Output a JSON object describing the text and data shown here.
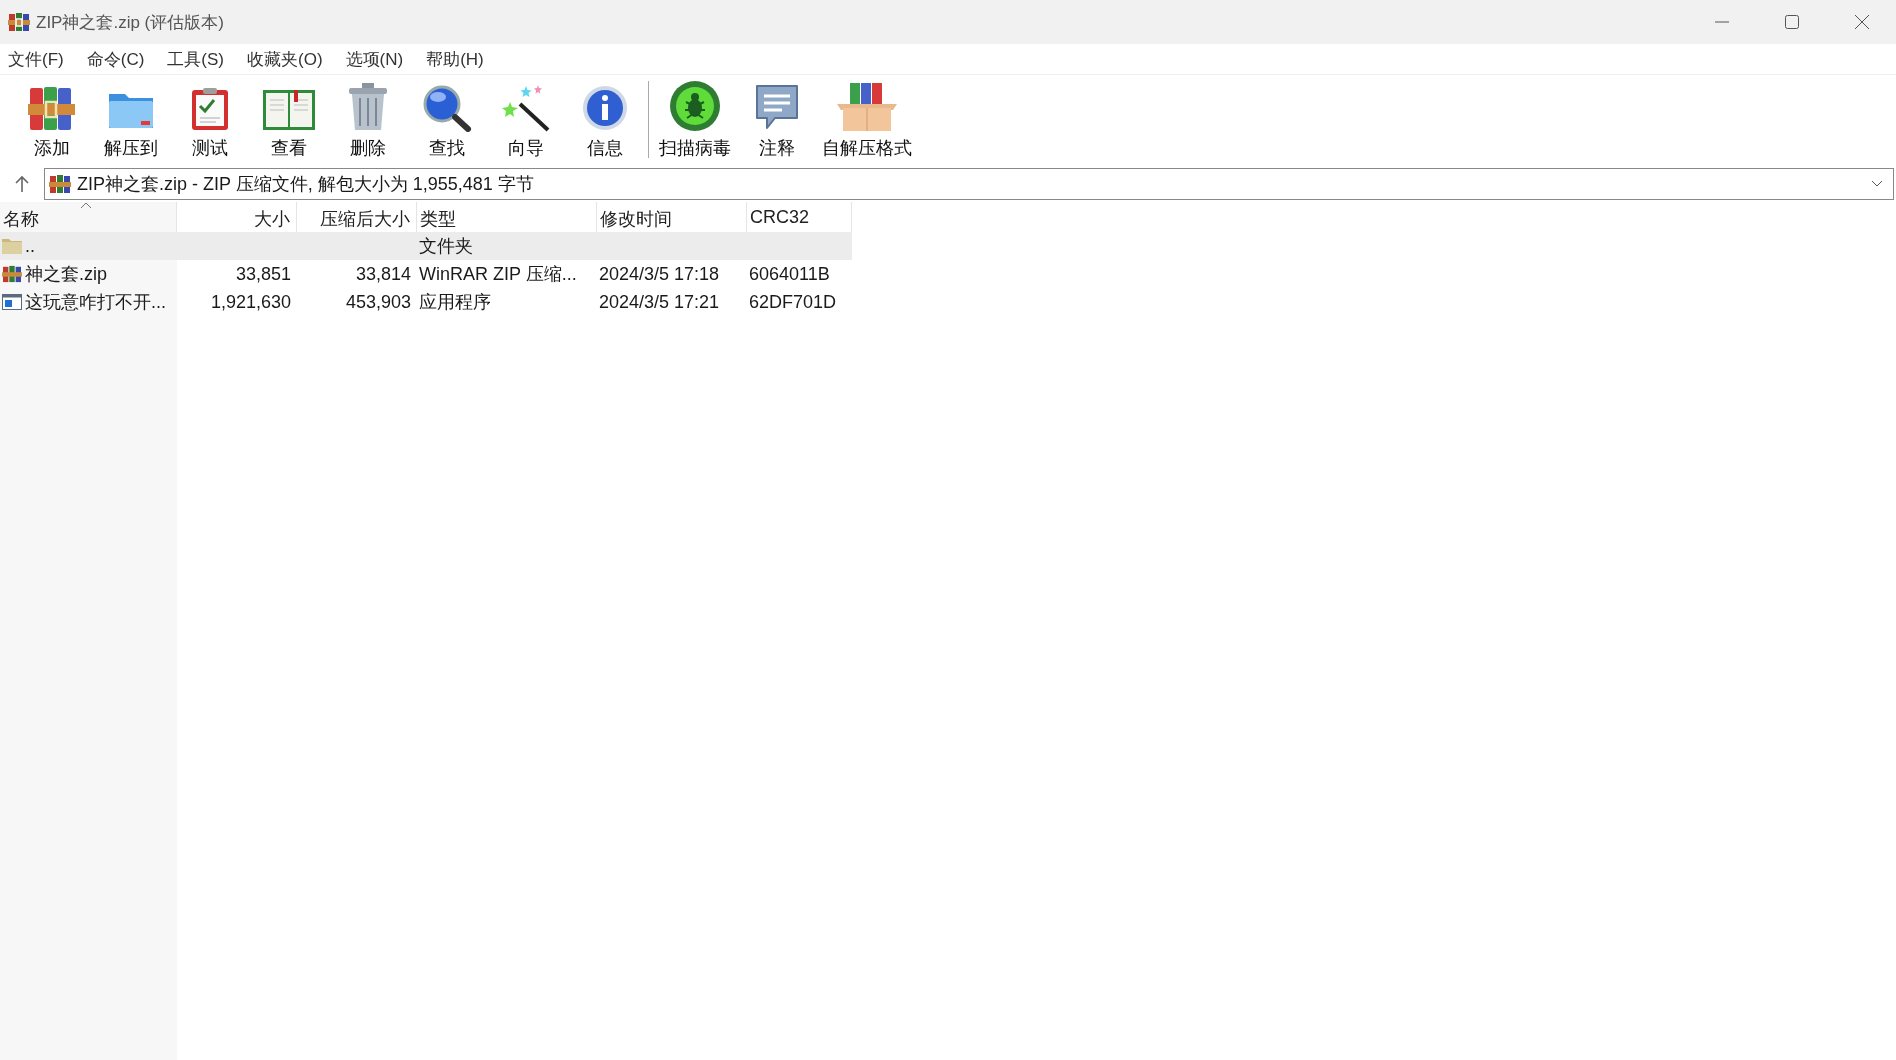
{
  "window": {
    "title": "ZIP神之套.zip (评估版本)"
  },
  "menu": [
    "文件(F)",
    "命令(C)",
    "工具(S)",
    "收藏夹(O)",
    "选项(N)",
    "帮助(H)"
  ],
  "toolbar": {
    "groups": [
      [
        "添加",
        "解压到",
        "测试",
        "查看",
        "删除",
        "查找",
        "向导",
        "信息"
      ],
      [
        "扫描病毒",
        "注释",
        "自解压格式"
      ]
    ]
  },
  "address": {
    "value": "ZIP神之套.zip - ZIP 压缩文件, 解包大小为 1,955,481 字节"
  },
  "table": {
    "columns": [
      {
        "label": "名称",
        "sorted": true
      },
      {
        "label": "大小",
        "sorted": false
      },
      {
        "label": "压缩后大小",
        "sorted": false
      },
      {
        "label": "类型",
        "sorted": false
      },
      {
        "label": "修改时间",
        "sorted": false
      },
      {
        "label": "CRC32",
        "sorted": false
      }
    ],
    "rows": [
      {
        "kind": "parent",
        "selected": true,
        "cells": [
          "..",
          "",
          "",
          "文件夹",
          "",
          ""
        ]
      },
      {
        "kind": "archive",
        "selected": false,
        "cells": [
          "神之套.zip",
          "33,851",
          "33,814",
          "WinRAR ZIP 压缩...",
          "2024/3/5 17:18",
          "6064011B"
        ]
      },
      {
        "kind": "program",
        "selected": false,
        "cells": [
          "这玩意咋打不开...",
          "1,921,630",
          "453,903",
          "应用程序",
          "2024/3/5 17:21",
          "62DF701D"
        ]
      }
    ]
  }
}
